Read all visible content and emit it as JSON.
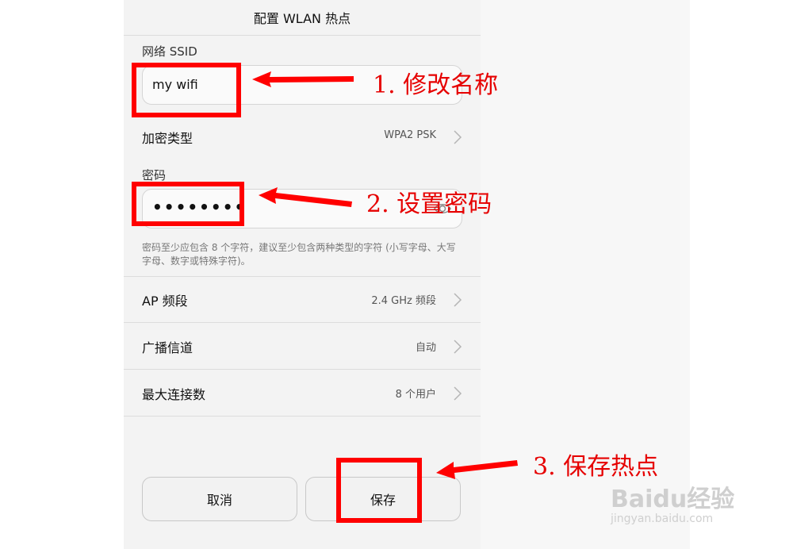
{
  "header": {
    "title": "配置 WLAN 热点"
  },
  "ssid": {
    "label": "网络 SSID",
    "value": "my wifi"
  },
  "encryption": {
    "title": "加密类型",
    "value": "WPA2 PSK"
  },
  "password": {
    "label": "密码",
    "value": "••••••••",
    "hint": "密码至少应包含 8 个字符，建议至少包含两种类型的字符 (小写字母、大写字母、数字或特殊字符)。"
  },
  "ap_band": {
    "title": "AP 频段",
    "value": "2.4 GHz 频段"
  },
  "channel": {
    "title": "广播信道",
    "value": "自动"
  },
  "max_conn": {
    "title": "最大连接数",
    "value": "8 个用户"
  },
  "buttons": {
    "cancel": "取消",
    "save": "保存"
  },
  "annotations": {
    "step1": "1. 修改名称",
    "step2": "2. 设置密码",
    "step3": "3. 保存热点",
    "annotation_color": "#ff0000"
  },
  "watermark": {
    "brand": "Baidu经验",
    "url": "jingyan.baidu.com"
  }
}
